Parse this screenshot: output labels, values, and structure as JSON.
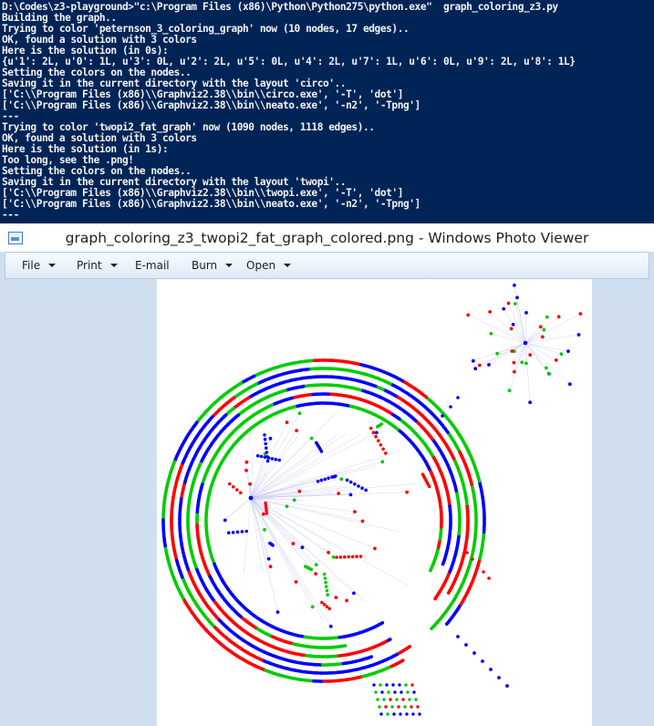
{
  "console": {
    "lines": [
      "D:\\Codes\\z3-playground>\"c:\\Program Files (x86)\\Python\\Python275\\python.exe\"  graph_coloring_z3.py",
      "Building the graph..",
      "Trying to color 'peternson_3_coloring_graph' now (10 nodes, 17 edges)..",
      "OK, found a solution with 3 colors",
      "Here is the solution (in 0s):",
      "{u'1': 2L, u'0': 1L, u'3': 0L, u'2': 2L, u'5': 0L, u'4': 2L, u'7': 1L, u'6': 0L, u'9': 2L, u'8': 1L}",
      "Setting the colors on the nodes..",
      "Saving it in the current directory with the layout 'circo'..",
      "['C:\\\\Program Files (x86)\\\\Graphviz2.38\\\\bin\\\\circo.exe', '-T', 'dot']",
      "['C:\\\\Program Files (x86)\\\\Graphviz2.38\\\\bin\\\\neato.exe', '-n2', '-Tpng']",
      "---",
      "Trying to color 'twopi2_fat_graph' now (1090 nodes, 1118 edges)..",
      "OK, found a solution with 3 colors",
      "Here is the solution (in 1s):",
      "Too long, see the .png!",
      "Setting the colors on the nodes..",
      "Saving it in the current directory with the layout 'twopi'..",
      "['C:\\\\Program Files (x86)\\\\Graphviz2.38\\\\bin\\\\twopi.exe', '-T', 'dot']",
      "['C:\\\\Program Files (x86)\\\\Graphviz2.38\\\\bin\\\\neato.exe', '-n2', '-Tpng']",
      "---"
    ],
    "background": "#012456",
    "foreground": "#f2f2f2"
  },
  "viewer": {
    "title": "graph_coloring_z3_twopi2_fat_graph_colored.png - Windows Photo Viewer",
    "app_icon": "photo-viewer-icon",
    "menu": {
      "file": "File",
      "print": "Print",
      "email": "E-mail",
      "burn": "Burn",
      "open": "Open"
    }
  },
  "graph": {
    "colors": {
      "red": "#ff0000",
      "green": "#00cc00",
      "blue": "#0000ff",
      "edge": "#9a9ae6"
    }
  }
}
